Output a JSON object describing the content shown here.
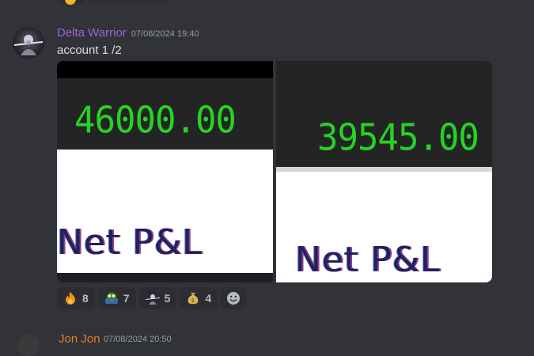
{
  "message": {
    "author": "Delta Warrior",
    "author_color": "#a062d6",
    "timestamp": "07/08/2024 19:40",
    "text": "account 1 /2",
    "attachments": [
      {
        "value_text": "46000.00",
        "label_text": "Net P&L"
      },
      {
        "value_text": "39545.00",
        "label_text": "Net P&L"
      }
    ],
    "reactions": [
      {
        "emoji": "fire-emoji",
        "count": "8"
      },
      {
        "emoji": "pepe-emoji",
        "count": "7"
      },
      {
        "emoji": "avatar-emoji",
        "count": "5"
      },
      {
        "emoji": "money-bag-emoji",
        "count": "4"
      }
    ]
  },
  "next_message": {
    "author": "Jon Jon",
    "author_color": "#e67e22",
    "timestamp": "07/08/2024 20:50"
  }
}
